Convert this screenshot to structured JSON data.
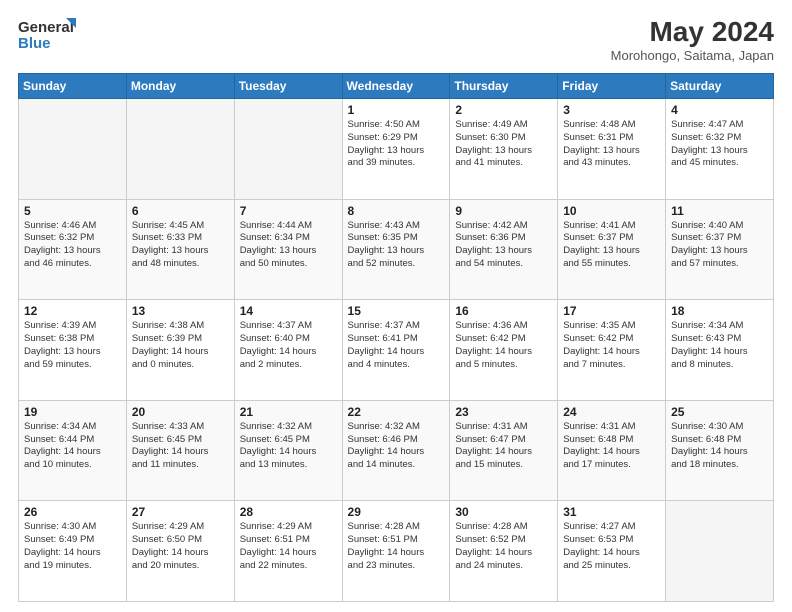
{
  "header": {
    "logo_line1": "General",
    "logo_line2": "Blue",
    "title": "May 2024",
    "subtitle": "Morohongo, Saitama, Japan"
  },
  "weekdays": [
    "Sunday",
    "Monday",
    "Tuesday",
    "Wednesday",
    "Thursday",
    "Friday",
    "Saturday"
  ],
  "weeks": [
    [
      {
        "day": "",
        "info": ""
      },
      {
        "day": "",
        "info": ""
      },
      {
        "day": "",
        "info": ""
      },
      {
        "day": "1",
        "info": "Sunrise: 4:50 AM\nSunset: 6:29 PM\nDaylight: 13 hours\nand 39 minutes."
      },
      {
        "day": "2",
        "info": "Sunrise: 4:49 AM\nSunset: 6:30 PM\nDaylight: 13 hours\nand 41 minutes."
      },
      {
        "day": "3",
        "info": "Sunrise: 4:48 AM\nSunset: 6:31 PM\nDaylight: 13 hours\nand 43 minutes."
      },
      {
        "day": "4",
        "info": "Sunrise: 4:47 AM\nSunset: 6:32 PM\nDaylight: 13 hours\nand 45 minutes."
      }
    ],
    [
      {
        "day": "5",
        "info": "Sunrise: 4:46 AM\nSunset: 6:32 PM\nDaylight: 13 hours\nand 46 minutes."
      },
      {
        "day": "6",
        "info": "Sunrise: 4:45 AM\nSunset: 6:33 PM\nDaylight: 13 hours\nand 48 minutes."
      },
      {
        "day": "7",
        "info": "Sunrise: 4:44 AM\nSunset: 6:34 PM\nDaylight: 13 hours\nand 50 minutes."
      },
      {
        "day": "8",
        "info": "Sunrise: 4:43 AM\nSunset: 6:35 PM\nDaylight: 13 hours\nand 52 minutes."
      },
      {
        "day": "9",
        "info": "Sunrise: 4:42 AM\nSunset: 6:36 PM\nDaylight: 13 hours\nand 54 minutes."
      },
      {
        "day": "10",
        "info": "Sunrise: 4:41 AM\nSunset: 6:37 PM\nDaylight: 13 hours\nand 55 minutes."
      },
      {
        "day": "11",
        "info": "Sunrise: 4:40 AM\nSunset: 6:37 PM\nDaylight: 13 hours\nand 57 minutes."
      }
    ],
    [
      {
        "day": "12",
        "info": "Sunrise: 4:39 AM\nSunset: 6:38 PM\nDaylight: 13 hours\nand 59 minutes."
      },
      {
        "day": "13",
        "info": "Sunrise: 4:38 AM\nSunset: 6:39 PM\nDaylight: 14 hours\nand 0 minutes."
      },
      {
        "day": "14",
        "info": "Sunrise: 4:37 AM\nSunset: 6:40 PM\nDaylight: 14 hours\nand 2 minutes."
      },
      {
        "day": "15",
        "info": "Sunrise: 4:37 AM\nSunset: 6:41 PM\nDaylight: 14 hours\nand 4 minutes."
      },
      {
        "day": "16",
        "info": "Sunrise: 4:36 AM\nSunset: 6:42 PM\nDaylight: 14 hours\nand 5 minutes."
      },
      {
        "day": "17",
        "info": "Sunrise: 4:35 AM\nSunset: 6:42 PM\nDaylight: 14 hours\nand 7 minutes."
      },
      {
        "day": "18",
        "info": "Sunrise: 4:34 AM\nSunset: 6:43 PM\nDaylight: 14 hours\nand 8 minutes."
      }
    ],
    [
      {
        "day": "19",
        "info": "Sunrise: 4:34 AM\nSunset: 6:44 PM\nDaylight: 14 hours\nand 10 minutes."
      },
      {
        "day": "20",
        "info": "Sunrise: 4:33 AM\nSunset: 6:45 PM\nDaylight: 14 hours\nand 11 minutes."
      },
      {
        "day": "21",
        "info": "Sunrise: 4:32 AM\nSunset: 6:45 PM\nDaylight: 14 hours\nand 13 minutes."
      },
      {
        "day": "22",
        "info": "Sunrise: 4:32 AM\nSunset: 6:46 PM\nDaylight: 14 hours\nand 14 minutes."
      },
      {
        "day": "23",
        "info": "Sunrise: 4:31 AM\nSunset: 6:47 PM\nDaylight: 14 hours\nand 15 minutes."
      },
      {
        "day": "24",
        "info": "Sunrise: 4:31 AM\nSunset: 6:48 PM\nDaylight: 14 hours\nand 17 minutes."
      },
      {
        "day": "25",
        "info": "Sunrise: 4:30 AM\nSunset: 6:48 PM\nDaylight: 14 hours\nand 18 minutes."
      }
    ],
    [
      {
        "day": "26",
        "info": "Sunrise: 4:30 AM\nSunset: 6:49 PM\nDaylight: 14 hours\nand 19 minutes."
      },
      {
        "day": "27",
        "info": "Sunrise: 4:29 AM\nSunset: 6:50 PM\nDaylight: 14 hours\nand 20 minutes."
      },
      {
        "day": "28",
        "info": "Sunrise: 4:29 AM\nSunset: 6:51 PM\nDaylight: 14 hours\nand 22 minutes."
      },
      {
        "day": "29",
        "info": "Sunrise: 4:28 AM\nSunset: 6:51 PM\nDaylight: 14 hours\nand 23 minutes."
      },
      {
        "day": "30",
        "info": "Sunrise: 4:28 AM\nSunset: 6:52 PM\nDaylight: 14 hours\nand 24 minutes."
      },
      {
        "day": "31",
        "info": "Sunrise: 4:27 AM\nSunset: 6:53 PM\nDaylight: 14 hours\nand 25 minutes."
      },
      {
        "day": "",
        "info": ""
      }
    ]
  ]
}
